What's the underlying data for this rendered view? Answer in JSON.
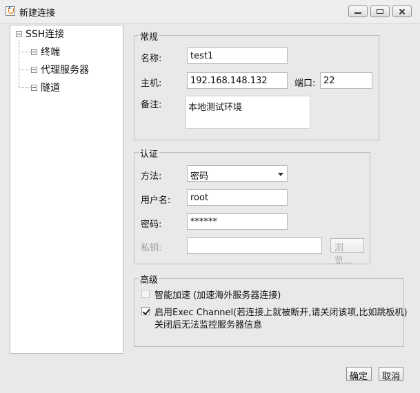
{
  "window": {
    "title": "新建连接"
  },
  "tree": {
    "root": "SSH连接",
    "items": [
      {
        "label": "终端"
      },
      {
        "label": "代理服务器"
      },
      {
        "label": "隧道"
      }
    ]
  },
  "general": {
    "title": "常规",
    "name_label": "名称:",
    "name_value": "test1",
    "host_label": "主机:",
    "host_value": "192.168.148.132",
    "port_label": "端口:",
    "port_value": "22",
    "note_label": "备注:",
    "note_value": "本地测试环境"
  },
  "auth": {
    "title": "认证",
    "method_label": "方法:",
    "method_value": "密码",
    "user_label": "用户名:",
    "user_value": "root",
    "password_label": "密码:",
    "password_value": "******",
    "key_label": "私钥:",
    "key_value": "",
    "browse_label": "浏览..."
  },
  "advanced": {
    "title": "高级",
    "option1": {
      "label": "智能加速 (加速海外服务器连接)",
      "checked": false,
      "enabled": false
    },
    "option2": {
      "line1": "启用Exec Channel(若连接上就被断开,请关闭该项,比如跳板机)",
      "line2": "关闭后无法监控服务器信息",
      "checked": true
    }
  },
  "footer": {
    "ok_label": "确定",
    "cancel_label": "取消"
  }
}
